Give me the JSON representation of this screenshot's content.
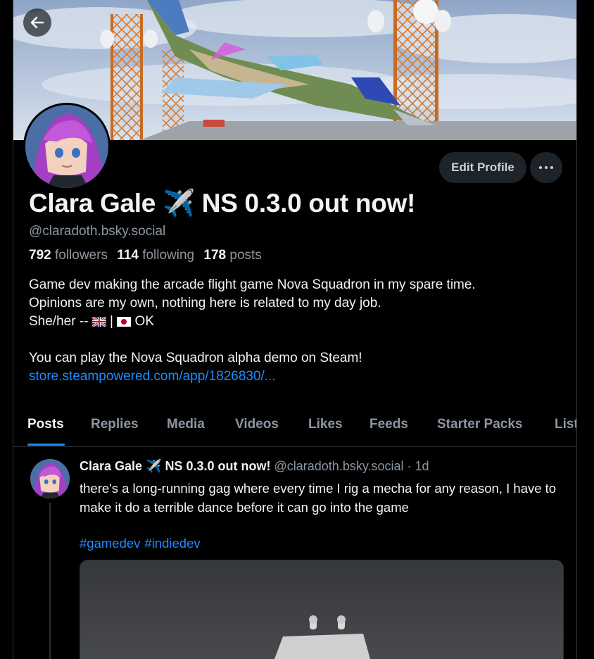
{
  "header": {
    "back_label": "Back"
  },
  "profile": {
    "display_name": "Clara Gale ✈️ NS 0.3.0 out now!",
    "handle": "@claradoth.bsky.social",
    "followers_count": "792",
    "followers_label": "followers",
    "following_count": "114",
    "following_label": "following",
    "posts_count": "178",
    "posts_label": "posts",
    "edit_label": "Edit Profile",
    "bio": {
      "line1": "Game dev making the arcade flight game Nova Squadron in my spare time.",
      "line2": "Opinions are my own, nothing here is related to my day job.",
      "line3_prefix": "She/her -- ",
      "line3_suffix": " OK",
      "line4": "You can play the Nova Squadron alpha demo on Steam!",
      "link": "store.steampowered.com/app/1826830/..."
    }
  },
  "tabs": [
    {
      "label": "Posts",
      "active": true
    },
    {
      "label": "Replies"
    },
    {
      "label": "Media"
    },
    {
      "label": "Videos"
    },
    {
      "label": "Likes"
    },
    {
      "label": "Feeds"
    },
    {
      "label": "Starter Packs"
    },
    {
      "label": "Lists"
    }
  ],
  "post": {
    "author_name": "Clara Gale ✈️ NS 0.3.0 out now!",
    "author_handle": "@claradoth.bsky.social",
    "time": "· 1d",
    "text": "there's a long-running gag where every time I rig a mecha for any reason, I have to make it do a terrible dance before it can go into the game",
    "tags": [
      "#gamedev",
      "#indiedev"
    ]
  },
  "colors": {
    "background": "#000000",
    "accent": "#208bfe",
    "muted_text": "#8c96a1",
    "button_bg": "#1e2329"
  },
  "icons": [
    "back-arrow-icon",
    "more-dots-icon",
    "airplane-emoji",
    "uk-flag-icon",
    "japan-flag-icon"
  ]
}
